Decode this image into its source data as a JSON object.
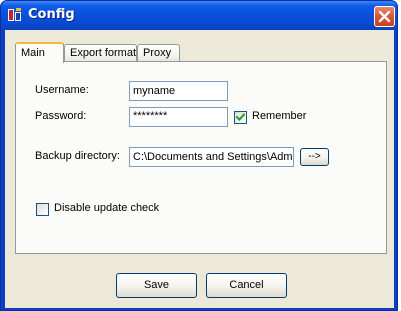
{
  "window": {
    "title": "Config"
  },
  "tabs": [
    {
      "label": "Main",
      "active": true
    },
    {
      "label": "Export format",
      "active": false
    },
    {
      "label": "Proxy",
      "active": false
    }
  ],
  "main": {
    "username_label": "Username:",
    "username_value": "myname",
    "password_label": "Password:",
    "password_value": "********",
    "remember_label": "Remember",
    "remember_checked": true,
    "backup_label": "Backup directory:",
    "backup_value": "C:\\Documents and Settings\\Admi",
    "browse_label": "-->",
    "disable_update_label": "Disable update check",
    "disable_update_checked": false
  },
  "buttons": {
    "save_label": "Save",
    "cancel_label": "Cancel"
  },
  "colors": {
    "titlebar": "#0a4fd8",
    "dialog_face": "#ece9d8",
    "close_button": "#d85a3a",
    "check_mark": "#21a121",
    "active_tab_highlight": "#f5b83a"
  },
  "icons": {
    "app": "app-icon",
    "close": "close-icon",
    "check": "checkmark-icon"
  }
}
